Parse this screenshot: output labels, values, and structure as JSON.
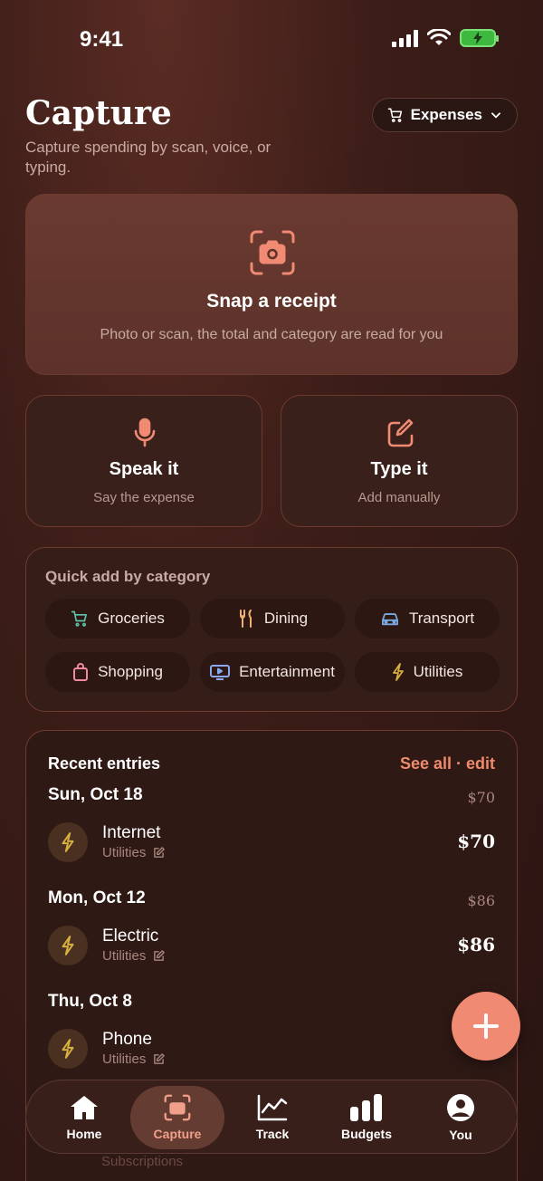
{
  "status": {
    "time": "9:41"
  },
  "header": {
    "title": "Capture",
    "subtitle": "Capture spending by scan, voice, or typing.",
    "mode": "Expenses"
  },
  "capture_options": {
    "snap": {
      "title": "Snap a receipt",
      "desc": "Photo or scan, the total and category are read for you"
    },
    "speak": {
      "title": "Speak it",
      "desc": "Say the expense"
    },
    "type": {
      "title": "Type it",
      "desc": "Add manually"
    }
  },
  "quick_add": {
    "heading": "Quick add by category",
    "categories": [
      {
        "label": "Groceries",
        "icon": "cart-icon",
        "color": "#5fc2a8"
      },
      {
        "label": "Dining",
        "icon": "fork-knife-icon",
        "color": "#f0b070"
      },
      {
        "label": "Transport",
        "icon": "car-icon",
        "color": "#7aa8e0"
      },
      {
        "label": "Shopping",
        "icon": "bag-icon",
        "color": "#f08aa0"
      },
      {
        "label": "Entertainment",
        "icon": "tv-icon",
        "color": "#8aa8f0"
      },
      {
        "label": "Utilities",
        "icon": "bolt-icon",
        "color": "#d8b040"
      }
    ]
  },
  "recent": {
    "heading": "Recent entries",
    "link": "See all · edit",
    "days": [
      {
        "label": "Sun, Oct 18",
        "total": "$70",
        "entry": {
          "name": "Internet",
          "category": "Utilities",
          "amount": "$70"
        }
      },
      {
        "label": "Mon, Oct 12",
        "total": "$86",
        "entry": {
          "name": "Electric",
          "category": "Utilities",
          "amount": "$86"
        }
      },
      {
        "label": "Thu, Oct 8",
        "total": "",
        "entry": {
          "name": "Phone",
          "category": "Utilities",
          "amount": ""
        }
      }
    ],
    "ghost_text": "Subscriptions"
  },
  "tabs": [
    {
      "label": "Home",
      "icon": "home-icon"
    },
    {
      "label": "Capture",
      "icon": "camera-icon",
      "active": true
    },
    {
      "label": "Track",
      "icon": "line-chart-icon"
    },
    {
      "label": "Budgets",
      "icon": "bar-chart-icon"
    },
    {
      "label": "You",
      "icon": "user-icon"
    }
  ],
  "colors": {
    "accent": "#f08a72",
    "bolt": "#d8b040"
  }
}
